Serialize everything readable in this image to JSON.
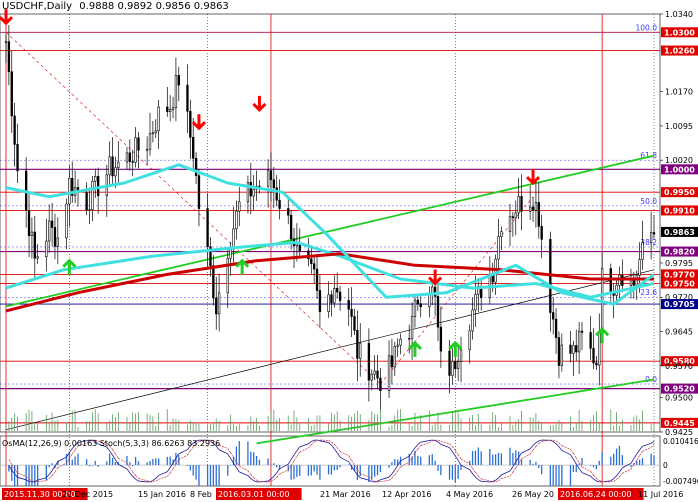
{
  "header": {
    "symbol": "USDCHF,Daily",
    "ohlc": "0.9888 0.9892 0.9856 0.9863"
  },
  "price_axis_labels": [
    "1.0340",
    "1.0300",
    "1.0260",
    "1.0170",
    "1.0095",
    "1.0020",
    "1.0000",
    "0.9950",
    "0.9910",
    "0.9863",
    "0.9820",
    "0.9795",
    "0.9770",
    "0.9750",
    "0.9720",
    "0.9705",
    "0.9645",
    "0.9580",
    "0.9570",
    "0.9520",
    "0.9500",
    "0.9445",
    "0.9425"
  ],
  "osc_axis_labels": [
    "0.010416",
    "0",
    "-0.007496"
  ],
  "fib_labels": [
    "100.0",
    "61.8",
    "50.0",
    "38.2",
    "23.6",
    "0.0"
  ],
  "date_labels": [
    "2015.11.30 00:00",
    "22 Dec 2015",
    "15 Jan 2016",
    "8 Feb",
    "2016.03.01 00:00",
    "21 Mar 2016",
    "12 Apr 2016",
    "4 May 2016",
    "26 May 20",
    "2016.06.24 00:00",
    "11 Jul 2016"
  ],
  "osc_title": "OsMA(12,26,9) 0.00163 Stoch(5,3,3) 86.6263 83.2936",
  "colors": {
    "red_level": "#e00000",
    "purple_level": "#800080",
    "blue_level": "#00008b",
    "bull_candle": "#ffffff",
    "bear_candle": "#000000",
    "ema_cyan": "#40e0e0",
    "ema_red": "#cc0000",
    "channel_green": "#22cc22",
    "buy_arrow": "#22cc22",
    "sell_arrow": "#ff0000",
    "current_price_bg": "#000000"
  },
  "chart_data": {
    "type": "candlestick",
    "symbol": "USDCHF",
    "timeframe": "Daily",
    "ohlc_current": {
      "open": 0.9888,
      "high": 0.9892,
      "low": 0.9856,
      "close": 0.9863
    },
    "y_range": [
      0.9425,
      1.034
    ],
    "x_range": [
      "2015-11-30",
      "2016-07-12"
    ],
    "close_path": [
      [
        "2015-11-30",
        1.028
      ],
      [
        "2015-12-04",
        1.0
      ],
      [
        "2015-12-08",
        0.988
      ],
      [
        "2015-12-10",
        0.98
      ],
      [
        "2015-12-15",
        0.987
      ],
      [
        "2015-12-18",
        0.985
      ],
      [
        "2015-12-22",
        0.997
      ],
      [
        "2015-12-28",
        0.993
      ],
      [
        "2016-01-05",
        1.0
      ],
      [
        "2016-01-12",
        1.003
      ],
      [
        "2016-01-18",
        1.006
      ],
      [
        "2016-01-22",
        1.012
      ],
      [
        "2016-01-26",
        1.014
      ],
      [
        "2016-01-29",
        1.02
      ],
      [
        "2016-02-03",
        1.004
      ],
      [
        "2016-02-05",
        0.992
      ],
      [
        "2016-02-09",
        0.978
      ],
      [
        "2016-02-11",
        0.97
      ],
      [
        "2016-02-15",
        0.983
      ],
      [
        "2016-02-19",
        0.992
      ],
      [
        "2016-02-24",
        0.996
      ],
      [
        "2016-03-01",
        0.998
      ],
      [
        "2016-03-04",
        0.993
      ],
      [
        "2016-03-08",
        0.987
      ],
      [
        "2016-03-11",
        0.98
      ],
      [
        "2016-03-16",
        0.976
      ],
      [
        "2016-03-18",
        0.968
      ],
      [
        "2016-03-23",
        0.975
      ],
      [
        "2016-03-28",
        0.97
      ],
      [
        "2016-03-31",
        0.96
      ],
      [
        "2016-04-05",
        0.956
      ],
      [
        "2016-04-08",
        0.954
      ],
      [
        "2016-04-12",
        0.957
      ],
      [
        "2016-04-15",
        0.963
      ],
      [
        "2016-04-19",
        0.966
      ],
      [
        "2016-04-21",
        0.972
      ],
      [
        "2016-04-25",
        0.975
      ],
      [
        "2016-04-27",
        0.971
      ],
      [
        "2016-04-29",
        0.958
      ],
      [
        "2016-05-03",
        0.956
      ],
      [
        "2016-05-06",
        0.963
      ],
      [
        "2016-05-10",
        0.969
      ],
      [
        "2016-05-13",
        0.974
      ],
      [
        "2016-05-17",
        0.978
      ],
      [
        "2016-05-20",
        0.989
      ],
      [
        "2016-05-24",
        0.991
      ],
      [
        "2016-05-27",
        0.993
      ],
      [
        "2016-05-31",
        0.994
      ],
      [
        "2016-06-02",
        0.99
      ],
      [
        "2016-06-06",
        0.971
      ],
      [
        "2016-06-09",
        0.96
      ],
      [
        "2016-06-14",
        0.96
      ],
      [
        "2016-06-17",
        0.963
      ],
      [
        "2016-06-22",
        0.958
      ],
      [
        "2016-06-24",
        0.976
      ],
      [
        "2016-06-28",
        0.975
      ],
      [
        "2016-06-30",
        0.978
      ],
      [
        "2016-07-05",
        0.975
      ],
      [
        "2016-07-07",
        0.98
      ],
      [
        "2016-07-11",
        0.986
      ],
      [
        "2016-07-12",
        0.9863
      ]
    ],
    "horizontal_levels": [
      {
        "price": 1.03,
        "color": "red",
        "label": "1.0300"
      },
      {
        "price": 1.026,
        "color": "red",
        "label": "1.0260"
      },
      {
        "price": 1.0,
        "color": "purple",
        "label": "1.0000"
      },
      {
        "price": 0.995,
        "color": "red",
        "label": "0.9950"
      },
      {
        "price": 0.991,
        "color": "red",
        "label": "0.9910"
      },
      {
        "price": 0.982,
        "color": "purple",
        "label": "0.9820"
      },
      {
        "price": 0.977,
        "color": "red",
        "label": "0.9770"
      },
      {
        "price": 0.975,
        "color": "red",
        "label": "0.9750"
      },
      {
        "price": 0.9705,
        "color": "blue",
        "label": "0.9705"
      },
      {
        "price": 0.958,
        "color": "red",
        "label": "0.9580"
      },
      {
        "price": 0.952,
        "color": "purple",
        "label": "0.9520"
      },
      {
        "price": 0.9445,
        "color": "red",
        "label": "0.9445"
      }
    ],
    "fibonacci": [
      {
        "level": "100.0",
        "price": 1.03
      },
      {
        "level": "61.8",
        "price": 1.002
      },
      {
        "level": "50.0",
        "price": 0.992
      },
      {
        "level": "38.2",
        "price": 0.983
      },
      {
        "level": "23.6",
        "price": 0.972
      },
      {
        "level": "0.0",
        "price": 0.953
      }
    ],
    "vertical_markers": [
      "2015-11-30",
      "2016-03-01",
      "2016-06-24"
    ],
    "dotted_verticals": [
      "2015-12-22",
      "2016-02-08",
      "2016-05-04",
      "2016-07-12"
    ],
    "ema_cyan_slow": [
      [
        "2015-11-30",
        0.974
      ],
      [
        "2015-12-20",
        0.978
      ],
      [
        "2016-01-20",
        0.981
      ],
      [
        "2016-02-20",
        0.983
      ],
      [
        "2016-03-10",
        0.984
      ],
      [
        "2016-03-25",
        0.981
      ],
      [
        "2016-04-15",
        0.976
      ],
      [
        "2016-05-10",
        0.974
      ],
      [
        "2016-06-01",
        0.975
      ],
      [
        "2016-06-20",
        0.972
      ],
      [
        "2016-07-12",
        0.975
      ]
    ],
    "ema_cyan_fast": [
      [
        "2015-11-30",
        0.996
      ],
      [
        "2015-12-15",
        0.994
      ],
      [
        "2016-01-10",
        0.997
      ],
      [
        "2016-01-29",
        1.001
      ],
      [
        "2016-02-15",
        0.997
      ],
      [
        "2016-03-05",
        0.995
      ],
      [
        "2016-03-20",
        0.986
      ],
      [
        "2016-04-10",
        0.972
      ],
      [
        "2016-05-01",
        0.973
      ],
      [
        "2016-05-25",
        0.979
      ],
      [
        "2016-06-10",
        0.973
      ],
      [
        "2016-06-28",
        0.9705
      ],
      [
        "2016-07-12",
        0.977
      ]
    ],
    "ema_red": [
      [
        "2015-11-30",
        0.969
      ],
      [
        "2015-12-25",
        0.973
      ],
      [
        "2016-01-25",
        0.977
      ],
      [
        "2016-02-25",
        0.98
      ],
      [
        "2016-03-25",
        0.9815
      ],
      [
        "2016-04-20",
        0.979
      ],
      [
        "2016-05-20",
        0.978
      ],
      [
        "2016-06-20",
        0.976
      ],
      [
        "2016-07-12",
        0.976
      ]
    ],
    "channel_lines": [
      {
        "from": [
          "2015-11-30",
          0.97
        ],
        "to": [
          "2016-07-12",
          1.003
        ],
        "color": "green"
      },
      {
        "from": [
          "2016-02-25",
          0.94
        ],
        "to": [
          "2016-07-12",
          0.954
        ],
        "color": "green"
      },
      {
        "from": [
          "2015-11-30",
          0.943
        ],
        "to": [
          "2016-07-12",
          0.978
        ],
        "color": "black"
      }
    ],
    "signals": [
      {
        "date": "2015-11-30",
        "type": "sell",
        "price": 1.032
      },
      {
        "date": "2015-12-22",
        "type": "buy",
        "price": 0.98
      },
      {
        "date": "2016-02-05",
        "type": "sell",
        "price": 1.009
      },
      {
        "date": "2016-02-20",
        "type": "buy",
        "price": 0.98
      },
      {
        "date": "2016-02-26",
        "type": "sell",
        "price": 1.013
      },
      {
        "date": "2016-04-20",
        "type": "buy",
        "price": 0.962
      },
      {
        "date": "2016-04-27",
        "type": "sell",
        "price": 0.975
      },
      {
        "date": "2016-05-04",
        "type": "buy",
        "price": 0.962
      },
      {
        "date": "2016-05-31",
        "type": "sell",
        "price": 0.997
      },
      {
        "date": "2016-06-24",
        "type": "buy",
        "price": 0.965
      }
    ],
    "oscillator": {
      "name": "OsMA(12,26,9) Stoch(5,3,3)",
      "osma_value": 0.00163,
      "stoch_main": 86.6263,
      "stoch_signal": 83.2936,
      "y_range": [
        -0.007496,
        0.010416
      ]
    }
  }
}
